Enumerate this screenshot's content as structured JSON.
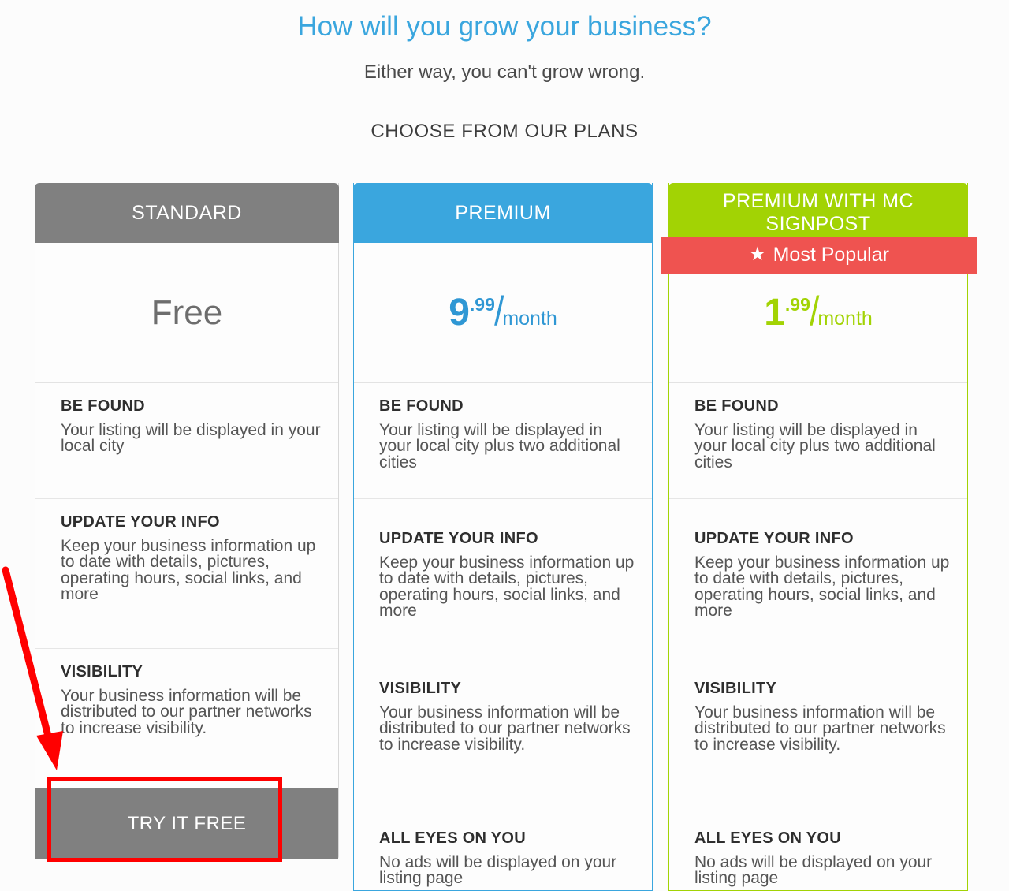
{
  "header": {
    "title": "How will you grow your business?",
    "subtitle": "Either way, you can't grow wrong.",
    "plans_label": "CHOOSE FROM OUR PLANS"
  },
  "colors": {
    "title_blue": "#3aa6de",
    "standard_gray": "#808080",
    "premium_blue": "#3aa6de",
    "mc_green": "#a2d304",
    "badge_red": "#ef5350",
    "annotation_red": "#ff0000",
    "page_background": "#fcfcfc"
  },
  "badge": {
    "icon": "star-icon",
    "glyph": "★",
    "label": "Most Popular"
  },
  "plans": [
    {
      "id": "standard",
      "name": "STANDARD",
      "price": {
        "display": "Free",
        "amount": "",
        "cents": "",
        "slash": "",
        "period": ""
      },
      "features": [
        {
          "title": "BE FOUND",
          "desc": "Your listing will be displayed in your local city"
        },
        {
          "title": "UPDATE YOUR INFO",
          "desc": "Keep your business information up to date with details, pictures, operating hours, social links, and more"
        },
        {
          "title": "VISIBILITY",
          "desc": "Your business information will be distributed to our partner networks to increase visibility."
        }
      ],
      "cta": "TRY IT FREE"
    },
    {
      "id": "premium",
      "name": "PREMIUM",
      "price": {
        "display": "",
        "amount": "9",
        "cents": ".99",
        "slash": "/",
        "period": "month"
      },
      "features": [
        {
          "title": "BE FOUND",
          "desc": "Your listing will be displayed in your local city plus two additional cities"
        },
        {
          "title": "UPDATE YOUR INFO",
          "desc": "Keep your business information up to date with details, pictures, operating hours, social links, and more"
        },
        {
          "title": "VISIBILITY",
          "desc": "Your business information will be distributed to our partner networks to increase visibility."
        },
        {
          "title": "ALL EYES ON YOU",
          "desc": "No ads will be displayed on your listing page"
        }
      ],
      "cta": ""
    },
    {
      "id": "premium-mc-signpost",
      "name": "PREMIUM WITH MC SIGNPOST",
      "price": {
        "display": "",
        "amount": "1",
        "cents": ".99",
        "slash": "/",
        "period": "month"
      },
      "features": [
        {
          "title": "BE FOUND",
          "desc": "Your listing will be displayed in your local city plus two additional cities"
        },
        {
          "title": "UPDATE YOUR INFO",
          "desc": "Keep your business information up to date with details, pictures, operating hours, social links, and more"
        },
        {
          "title": "VISIBILITY",
          "desc": "Your business information will be distributed to our partner networks to increase visibility."
        },
        {
          "title": "ALL EYES ON YOU",
          "desc": "No ads will be displayed on your listing page"
        }
      ],
      "cta": ""
    }
  ]
}
